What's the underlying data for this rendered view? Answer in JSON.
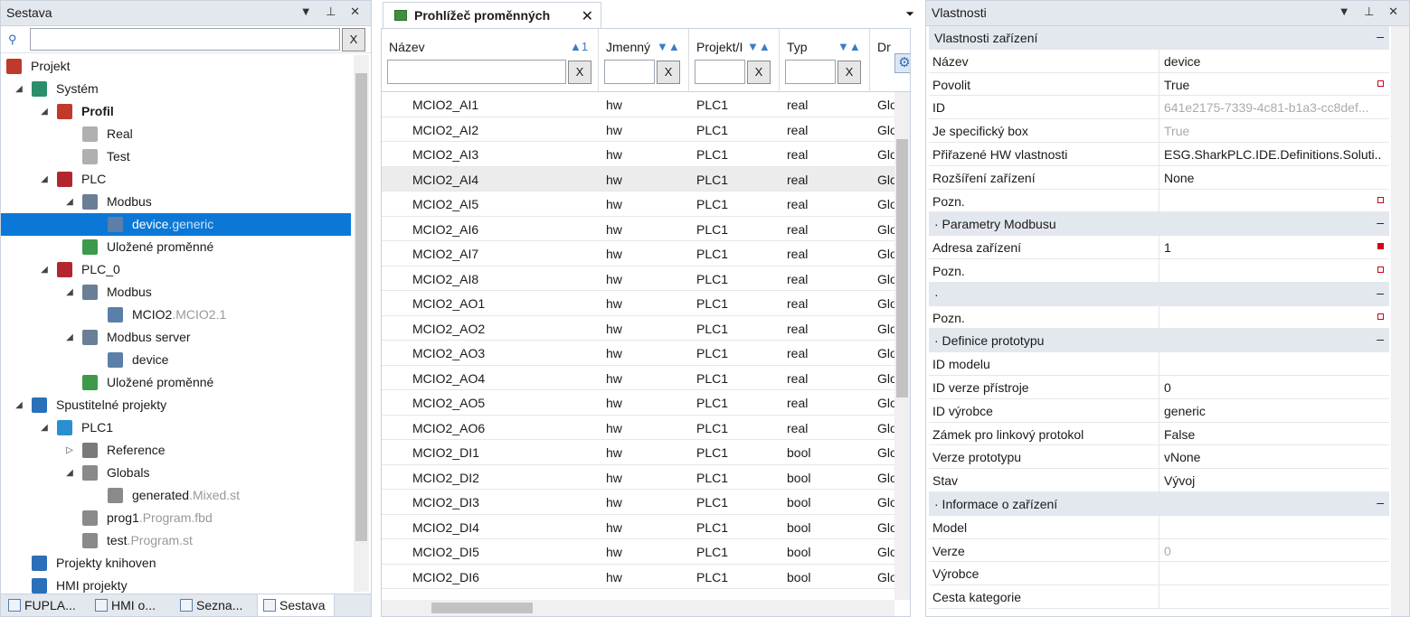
{
  "left_panel": {
    "title": "Sestava",
    "filter_value": "",
    "clear_label": "X",
    "tree": [
      {
        "label": "Projekt",
        "suffix": "",
        "bold": false,
        "indent": 0,
        "arrow": "",
        "icon": "project-icon",
        "color": "#c0392b"
      },
      {
        "label": "Systém",
        "suffix": "",
        "bold": false,
        "indent": 1,
        "arrow": "◢",
        "icon": "system-icon",
        "color": "#2a8f6a"
      },
      {
        "label": "Profil",
        "suffix": "",
        "bold": true,
        "indent": 2,
        "arrow": "◢",
        "icon": "gear-icon",
        "color": "#c0392b"
      },
      {
        "label": "Real",
        "suffix": "",
        "bold": false,
        "indent": 3,
        "arrow": "",
        "icon": "gear-icon",
        "color": "#b0b0b0"
      },
      {
        "label": "Test",
        "suffix": "",
        "bold": false,
        "indent": 3,
        "arrow": "",
        "icon": "gear-icon",
        "color": "#b0b0b0"
      },
      {
        "label": "PLC",
        "suffix": "",
        "bold": false,
        "indent": 2,
        "arrow": "◢",
        "icon": "plc-icon",
        "color": "#b3262f"
      },
      {
        "label": "Modbus",
        "suffix": "",
        "bold": false,
        "indent": 3,
        "arrow": "◢",
        "icon": "modbus-icon",
        "color": "#6a7f96"
      },
      {
        "label": "device",
        "suffix": ".generic",
        "bold": false,
        "indent": 4,
        "arrow": "",
        "icon": "device-icon",
        "color": "#5b7fa8",
        "selected": true
      },
      {
        "label": "Uložené proměnné",
        "suffix": "",
        "bold": false,
        "indent": 3,
        "arrow": "",
        "icon": "saved-vars-icon",
        "color": "#3c9a4a"
      },
      {
        "label": "PLC_0",
        "suffix": "",
        "bold": false,
        "indent": 2,
        "arrow": "◢",
        "icon": "plc-icon",
        "color": "#b3262f"
      },
      {
        "label": "Modbus",
        "suffix": "",
        "bold": false,
        "indent": 3,
        "arrow": "◢",
        "icon": "modbus-icon",
        "color": "#6a7f96"
      },
      {
        "label": "MCIO2",
        "suffix": ".MCIO2.1",
        "bold": false,
        "indent": 4,
        "arrow": "",
        "icon": "device-icon",
        "color": "#5b7fa8"
      },
      {
        "label": "Modbus server",
        "suffix": "",
        "bold": false,
        "indent": 3,
        "arrow": "◢",
        "icon": "modbus-icon",
        "color": "#6a7f96"
      },
      {
        "label": "device",
        "suffix": "",
        "bold": false,
        "indent": 4,
        "arrow": "",
        "icon": "device-icon",
        "color": "#5b7fa8"
      },
      {
        "label": "Uložené proměnné",
        "suffix": "",
        "bold": false,
        "indent": 3,
        "arrow": "",
        "icon": "saved-vars-icon",
        "color": "#3c9a4a"
      },
      {
        "label": "Spustitelné projekty",
        "suffix": "",
        "bold": false,
        "indent": 1,
        "arrow": "◢",
        "icon": "runnable-icon",
        "color": "#2a6fb8"
      },
      {
        "label": "PLC1",
        "suffix": "",
        "bold": false,
        "indent": 2,
        "arrow": "◢",
        "icon": "folder-icon",
        "color": "#2a8fd0"
      },
      {
        "label": "Reference",
        "suffix": "",
        "bold": false,
        "indent": 3,
        "arrow": "▷",
        "icon": "reference-icon",
        "color": "#7a7a7a"
      },
      {
        "label": "Globals",
        "suffix": "",
        "bold": false,
        "indent": 3,
        "arrow": "◢",
        "icon": "folder-icon",
        "color": "#8a8a8a"
      },
      {
        "label": "generated",
        "suffix": ".Mixed.st",
        "bold": false,
        "indent": 4,
        "arrow": "",
        "icon": "file-icon",
        "color": "#8a8a8a"
      },
      {
        "label": "prog1",
        "suffix": ".Program.fbd",
        "bold": false,
        "indent": 3,
        "arrow": "",
        "icon": "file-icon",
        "color": "#8a8a8a"
      },
      {
        "label": "test",
        "suffix": ".Program.st",
        "bold": false,
        "indent": 3,
        "arrow": "",
        "icon": "file-icon",
        "color": "#8a8a8a"
      },
      {
        "label": "Projekty knihoven",
        "suffix": "",
        "bold": false,
        "indent": 1,
        "arrow": "",
        "icon": "library-icon",
        "color": "#2a6fb8"
      },
      {
        "label": "HMI projekty",
        "suffix": "",
        "bold": false,
        "indent": 1,
        "arrow": "",
        "icon": "hmi-icon",
        "color": "#2a6fb8"
      }
    ],
    "bottom_tabs": [
      {
        "label": "FUPLA...",
        "active": false
      },
      {
        "label": "HMI o...",
        "active": false
      },
      {
        "label": "Sezna...",
        "active": false
      },
      {
        "label": "Sestava",
        "active": true
      }
    ]
  },
  "middle_panel": {
    "tab_title": "Prohlížeč proměnných",
    "close_label": "✕",
    "columns": [
      {
        "label": "Název",
        "sort": "▲1"
      },
      {
        "label": "Jmenný",
        "sort": "▼▲"
      },
      {
        "label": "Projekt/I",
        "sort": "▼▲"
      },
      {
        "label": "Typ",
        "sort": "▼▲"
      },
      {
        "label": "Dr",
        "sort": ""
      }
    ],
    "filter_clear": "X",
    "rows": [
      [
        "MCIO2_AI1",
        "hw",
        "PLC1",
        "real",
        "Glo"
      ],
      [
        "MCIO2_AI2",
        "hw",
        "PLC1",
        "real",
        "Glo"
      ],
      [
        "MCIO2_AI3",
        "hw",
        "PLC1",
        "real",
        "Glo"
      ],
      [
        "MCIO2_AI4",
        "hw",
        "PLC1",
        "real",
        "Glo"
      ],
      [
        "MCIO2_AI5",
        "hw",
        "PLC1",
        "real",
        "Glo"
      ],
      [
        "MCIO2_AI6",
        "hw",
        "PLC1",
        "real",
        "Glo"
      ],
      [
        "MCIO2_AI7",
        "hw",
        "PLC1",
        "real",
        "Glo"
      ],
      [
        "MCIO2_AI8",
        "hw",
        "PLC1",
        "real",
        "Glo"
      ],
      [
        "MCIO2_AO1",
        "hw",
        "PLC1",
        "real",
        "Glo"
      ],
      [
        "MCIO2_AO2",
        "hw",
        "PLC1",
        "real",
        "Glo"
      ],
      [
        "MCIO2_AO3",
        "hw",
        "PLC1",
        "real",
        "Glo"
      ],
      [
        "MCIO2_AO4",
        "hw",
        "PLC1",
        "real",
        "Glo"
      ],
      [
        "MCIO2_AO5",
        "hw",
        "PLC1",
        "real",
        "Glo"
      ],
      [
        "MCIO2_AO6",
        "hw",
        "PLC1",
        "real",
        "Glo"
      ],
      [
        "MCIO2_DI1",
        "hw",
        "PLC1",
        "bool",
        "Glo"
      ],
      [
        "MCIO2_DI2",
        "hw",
        "PLC1",
        "bool",
        "Glo"
      ],
      [
        "MCIO2_DI3",
        "hw",
        "PLC1",
        "bool",
        "Glo"
      ],
      [
        "MCIO2_DI4",
        "hw",
        "PLC1",
        "bool",
        "Glo"
      ],
      [
        "MCIO2_DI5",
        "hw",
        "PLC1",
        "bool",
        "Glo"
      ],
      [
        "MCIO2_DI6",
        "hw",
        "PLC1",
        "bool",
        "Glo"
      ]
    ]
  },
  "right_panel": {
    "title": "Vlastnosti",
    "props": [
      {
        "cat": true,
        "key": "Vlastnosti zařízení"
      },
      {
        "key": "Název",
        "val": "device",
        "mark": ""
      },
      {
        "key": "Povolit",
        "val": "True",
        "mark": "outline"
      },
      {
        "key": "ID",
        "val": "641e2175-7339-4c81-b1a3-cc8def...",
        "mark": "",
        "grey": true
      },
      {
        "key": "Je specifický box",
        "val": "True",
        "mark": "",
        "grey": true
      },
      {
        "key": "Přiřazené HW vlastnosti",
        "val": "ESG.SharkPLC.IDE.Definitions.Soluti...",
        "mark": ""
      },
      {
        "key": "Rozšíření zařízení",
        "val": "None",
        "mark": ""
      },
      {
        "key": "Pozn.",
        "val": "",
        "mark": "outline"
      },
      {
        "cat": true,
        "key": "· Parametry Modbusu"
      },
      {
        "key": "Adresa zařízení",
        "val": "1",
        "mark": "fill"
      },
      {
        "key": "Pozn.",
        "val": "",
        "mark": "outline"
      },
      {
        "cat": true,
        "key": "·"
      },
      {
        "key": "Pozn.",
        "val": "",
        "mark": "outline"
      },
      {
        "cat": true,
        "key": "· Definice prototypu"
      },
      {
        "key": "ID modelu",
        "val": "",
        "mark": ""
      },
      {
        "key": "ID verze přístroje",
        "val": "0",
        "mark": ""
      },
      {
        "key": "ID výrobce",
        "val": "generic",
        "mark": ""
      },
      {
        "key": "Zámek pro linkový protokol",
        "val": "False",
        "mark": ""
      },
      {
        "key": "Verze prototypu",
        "val": "vNone",
        "mark": ""
      },
      {
        "key": "Stav",
        "val": "Vývoj",
        "mark": ""
      },
      {
        "cat": true,
        "key": "· Informace o zařízení"
      },
      {
        "key": "Model",
        "val": "",
        "mark": ""
      },
      {
        "key": "Verze",
        "val": "0",
        "mark": "",
        "grey": true
      },
      {
        "key": "Výrobce",
        "val": "",
        "mark": ""
      },
      {
        "key": "Cesta kategorie",
        "val": "",
        "mark": ""
      }
    ],
    "collapse_label": "–"
  },
  "pane_tools": "▼ ⊥ ✕"
}
